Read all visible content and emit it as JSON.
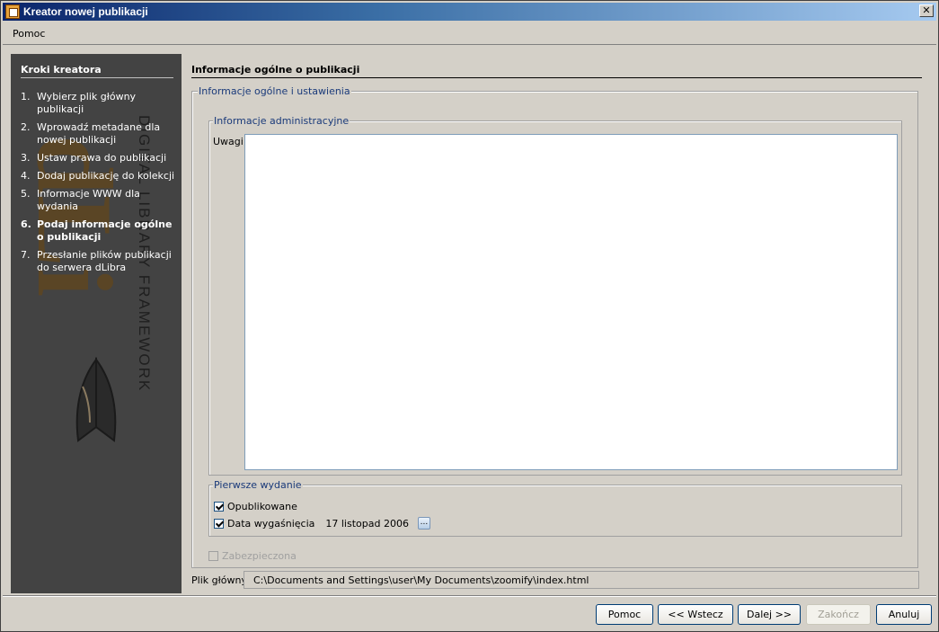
{
  "window": {
    "title": "Kreator nowej publikacji",
    "close_glyph": "✕"
  },
  "menu": {
    "help": "Pomoc"
  },
  "sidebar": {
    "title": "Kroki kreatora",
    "watermark": "DIGITAL LIBRARY FRAMEWORK",
    "steps": [
      {
        "num": "1.",
        "label": "Wybierz plik główny publikacji",
        "active": false
      },
      {
        "num": "2.",
        "label": "Wprowadź metadane dla nowej publikacji",
        "active": false
      },
      {
        "num": "3.",
        "label": "Ustaw prawa do publikacji",
        "active": false
      },
      {
        "num": "4.",
        "label": "Dodaj publikację do kolekcji",
        "active": false
      },
      {
        "num": "5.",
        "label": "Informacje WWW dla wydania",
        "active": false
      },
      {
        "num": "6.",
        "label": "Podaj informacje ogólne o publikacji",
        "active": true
      },
      {
        "num": "7.",
        "label": "Przesłanie plików publikacji do serwera dLibra",
        "active": false
      }
    ]
  },
  "main": {
    "title": "Informacje ogólne o publikacji",
    "general_group": "Informacje ogólne i ustawienia",
    "admin_group": "Informacje administracyjne",
    "notes_label": "Uwagi",
    "notes_value": "",
    "first_edition_group": "Pierwsze wydanie",
    "published_label": "Opublikowane",
    "published_checked": true,
    "expiry_label": "Data wygaśnięcia",
    "expiry_checked": true,
    "expiry_date": "17 listopad 2006",
    "date_button": "...",
    "secured_label": "Zabezpieczona",
    "secured_checked": false,
    "file_label": "Plik główny",
    "file_path": "C:\\Documents and Settings\\user\\My Documents\\zoomify\\index.html"
  },
  "buttons": {
    "help": "Pomoc",
    "back": "<< Wstecz",
    "next": "Dalej >>",
    "finish": "Zakończ",
    "cancel": "Anuluj"
  },
  "colors": {
    "sidebar_bg": "#434343",
    "group_label": "#1a3a7a",
    "window_bg": "#d4d0c8"
  }
}
